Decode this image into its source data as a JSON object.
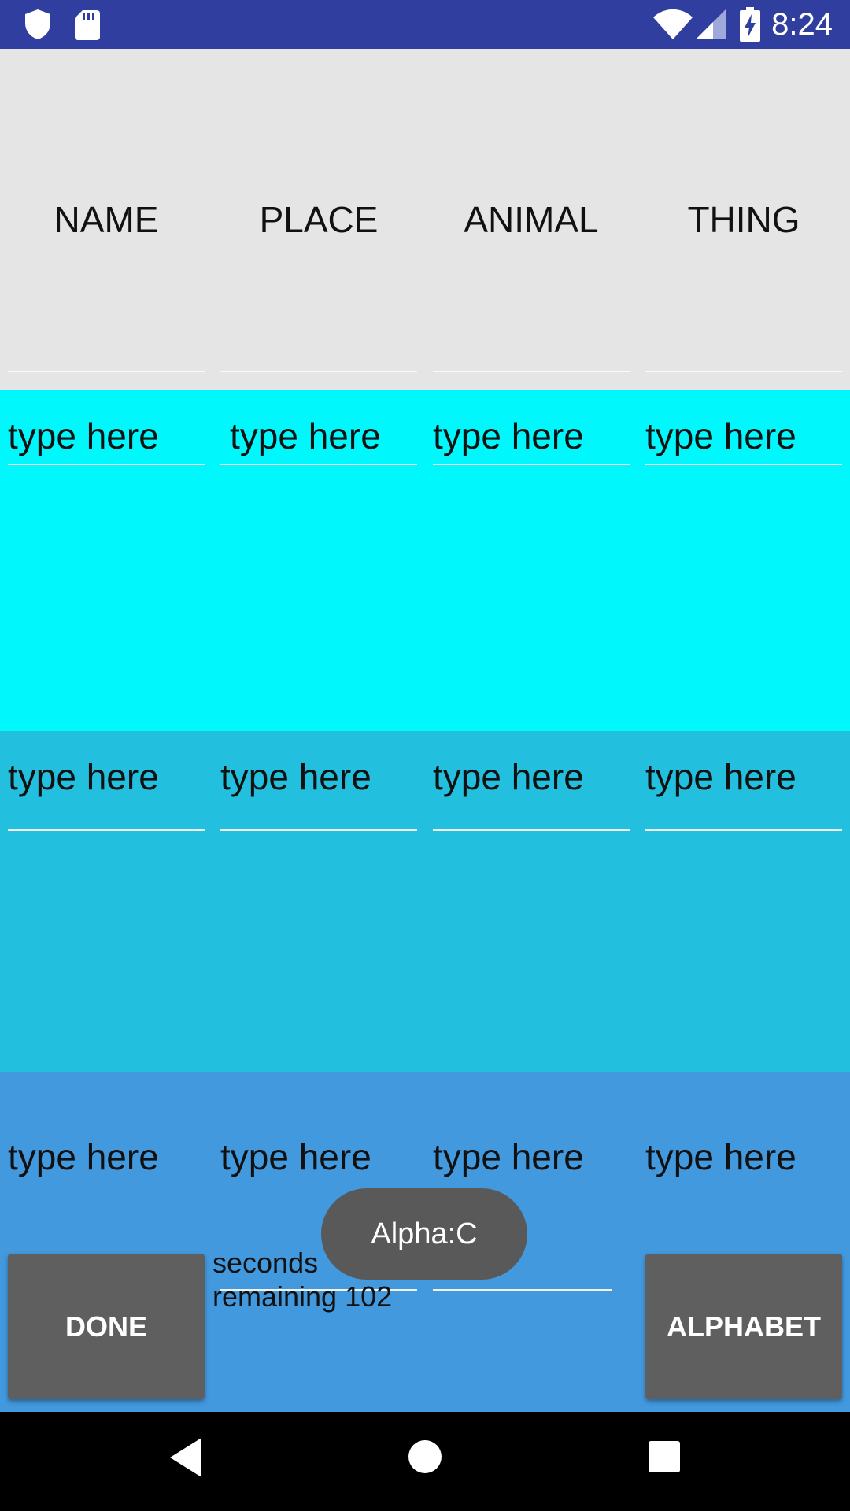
{
  "status_bar": {
    "time": "8:24",
    "icons": [
      "shield-icon",
      "sd-card-icon",
      "wifi-icon",
      "cell-signal-icon",
      "battery-charging-icon"
    ],
    "background": "#303f9f"
  },
  "columns": [
    "NAME",
    "PLACE",
    "ANIMAL",
    "THING"
  ],
  "rows": [
    {
      "background": "#00f8fd",
      "placeholders": [
        "type here",
        "type here",
        "type here",
        "type here"
      ]
    },
    {
      "background": "#22bfdf",
      "placeholders": [
        "type here",
        "type here",
        "type here",
        "type here"
      ]
    },
    {
      "background": "#4399de",
      "placeholders": [
        "type here",
        "type here",
        "type here",
        "type here"
      ]
    }
  ],
  "controls": {
    "done_label": "DONE",
    "alphabet_label": "ALPHABET",
    "timer_line1": "seconds",
    "timer_line2": "remaining 102"
  },
  "toast": {
    "text": "Alpha:C"
  },
  "nav_bar": {
    "icons": [
      "back-icon",
      "home-icon",
      "recents-icon"
    ]
  }
}
